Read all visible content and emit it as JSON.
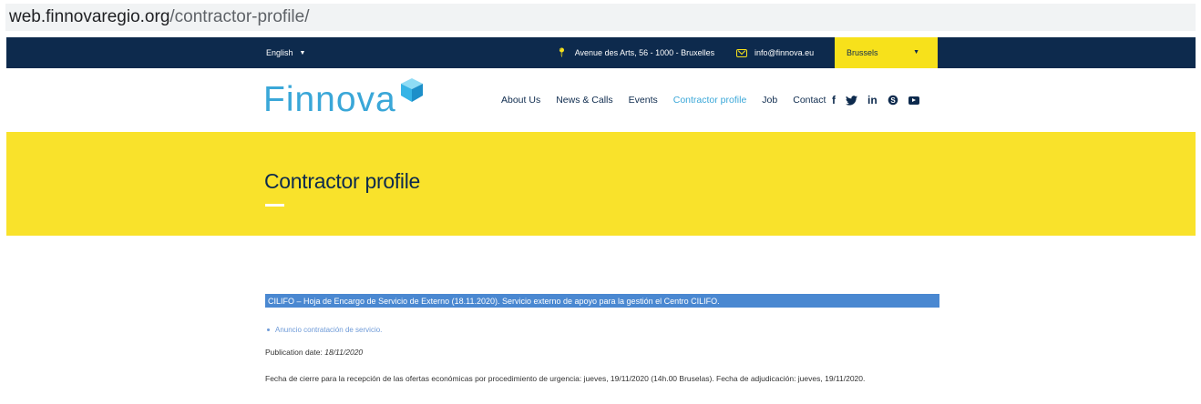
{
  "browser": {
    "url_domain": "web.finnovaregio.org",
    "url_path": "/contractor-profile/"
  },
  "topbar": {
    "language": "English",
    "address": "Avenue des Arts, 56 - 1000 - Bruxelles",
    "email": "info@finnova.eu",
    "city": "Brussels"
  },
  "header": {
    "logo_text": "Finnova",
    "menu": [
      "About Us",
      "News & Calls",
      "Events",
      "Contractor profile",
      "Job",
      "Contact"
    ],
    "active_menu": "Contractor profile",
    "social": [
      "facebook-icon",
      "twitter-icon",
      "linkedin-icon",
      "skype-icon",
      "youtube-icon"
    ]
  },
  "hero": {
    "title": "Contractor profile",
    "background": "#f9e22b"
  },
  "entry": {
    "heading": "CILIFO – Hoja de Encargo de Servicio de Externo (18.11.2020). Servicio externo de apoyo para la gestión el Centro CILIFO.",
    "link": "Anuncio contratación de servicio.",
    "publication_label": "Publication date:",
    "publication_date": "18/11/2020",
    "description": "Fecha de cierre para la recepción de las ofertas económicas por procedimiento de urgencia: jueves, 19/11/2020 (14h.00 Bruselas). Fecha de adjudicación: jueves, 19/11/2020."
  },
  "colors": {
    "navy": "#0d2a4d",
    "yellow": "#f7e11b",
    "accent_blue": "#3aa7d8",
    "entry_bar": "#4a88d1"
  }
}
